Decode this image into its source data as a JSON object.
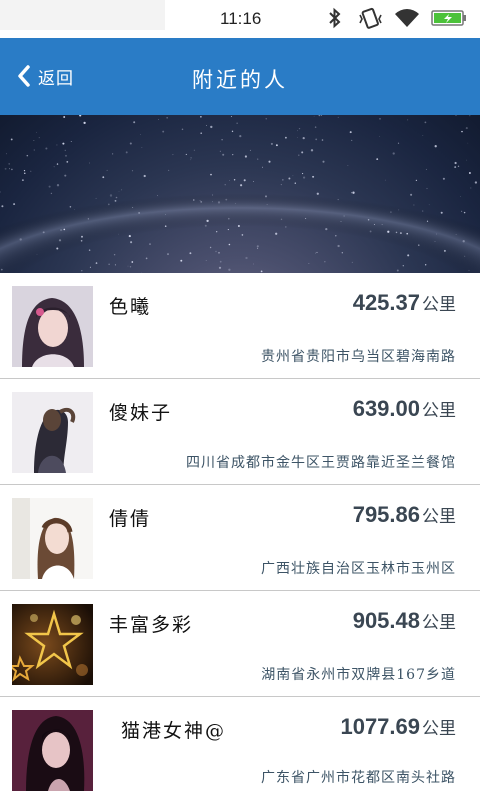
{
  "status_bar": {
    "time": "11:16",
    "icons": [
      "bluetooth-icon",
      "vibrate-icon",
      "wifi-icon",
      "battery-charging-icon"
    ]
  },
  "header": {
    "back_label": "返回",
    "title": "附近的人"
  },
  "colors": {
    "header_bg": "#2a7cc6",
    "distance_text": "#3a4652",
    "address_text": "#3d5466",
    "battery_fill": "#4cc23a"
  },
  "people": [
    {
      "name": "色曦",
      "distance": "425.37",
      "unit": "公里",
      "address": "贵州省贵阳市乌当区碧海南路"
    },
    {
      "name": "傻妹子",
      "distance": "639.00",
      "unit": "公里",
      "address": "四川省成都市金牛区王贾路靠近圣兰餐馆"
    },
    {
      "name": "倩倩",
      "distance": "795.86",
      "unit": "公里",
      "address": "广西壮族自治区玉林市玉州区"
    },
    {
      "name": "丰富多彩",
      "distance": "905.48",
      "unit": "公里",
      "address": "湖南省永州市双牌县167乡道"
    },
    {
      "name": "猫港女神@",
      "distance": "1077.69",
      "unit": "公里",
      "address": "广东省广州市花都区南头社路"
    }
  ]
}
